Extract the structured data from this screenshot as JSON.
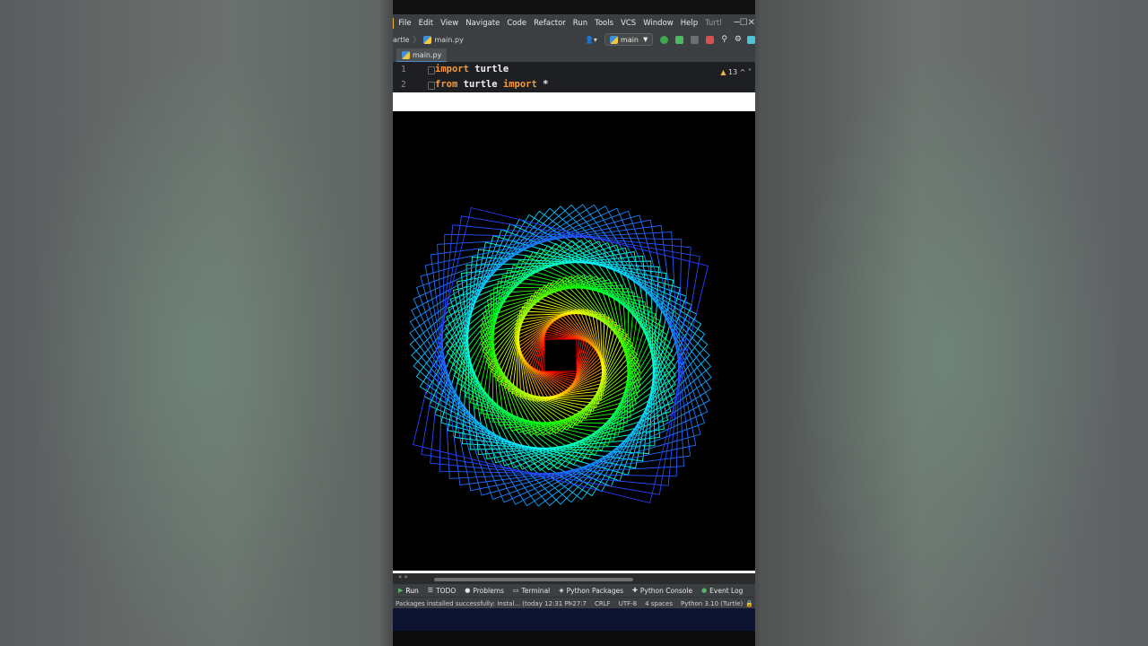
{
  "menubar": {
    "items": [
      "File",
      "Edit",
      "View",
      "Navigate",
      "Code",
      "Refactor",
      "Run",
      "Tools",
      "VCS",
      "Window",
      "Help"
    ],
    "title": "Turtl",
    "window_buttons": [
      "─",
      "☐",
      "✕"
    ]
  },
  "navbar": {
    "breadcrumb_project": "artle",
    "breadcrumb_file": "main.py",
    "branch": "main"
  },
  "tab": {
    "label": "main.py"
  },
  "editor": {
    "lines": [
      {
        "number": "1",
        "keyword": "import",
        "text": " turtle"
      },
      {
        "number": "2",
        "keyword": "from",
        "text2": " turtle ",
        "keyword2": "import",
        "text3": " *"
      }
    ],
    "warnings": "13"
  },
  "canvas": {
    "description_colors": [
      "#ff0000",
      "#ffff00",
      "#00ff00",
      "#00ffff",
      "#0000ff"
    ],
    "shape_count": 90
  },
  "toolwindows": [
    "Run",
    "TODO",
    "Problems",
    "Terminal",
    "Python Packages",
    "Python Console",
    "Event Log"
  ],
  "status": {
    "message": "Packages installed successfully: Instal... (today 12:31 PM)",
    "position": "27:7",
    "line_sep": "CRLF",
    "encoding": "UTF-8",
    "indent": "4 spaces",
    "interpreter": "Python 3.10 (Turtle)"
  }
}
